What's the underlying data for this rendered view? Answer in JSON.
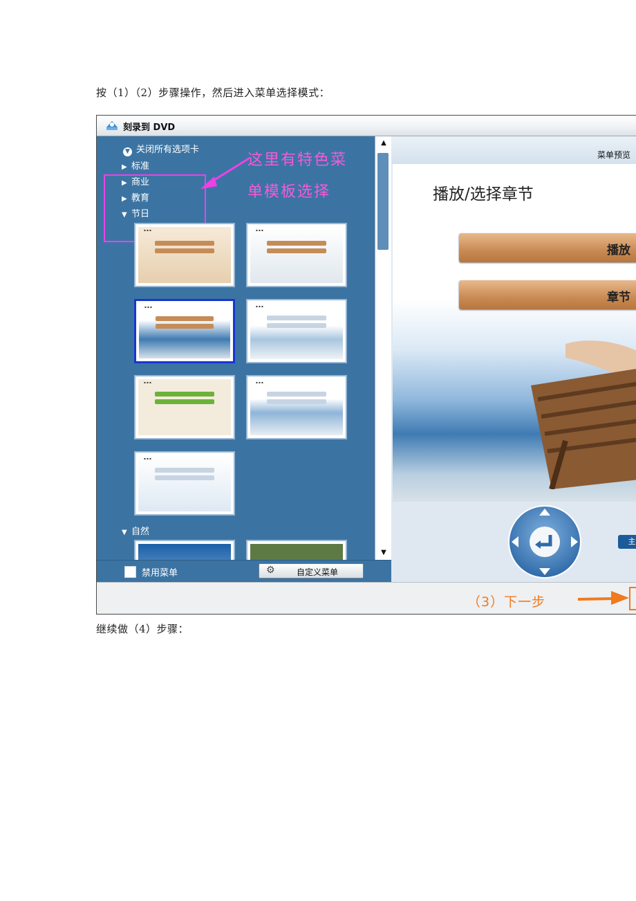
{
  "doc": {
    "para1": "按（1）（2）步骤操作，然后进入菜单选择模式：",
    "para2": "继续做（4）步骤："
  },
  "window": {
    "title": "刻录到 DVD",
    "close_all_tabs": "关闭所有选项卡",
    "tree": [
      {
        "label": "标准",
        "expanded": false
      },
      {
        "label": "商业",
        "expanded": false
      },
      {
        "label": "教育",
        "expanded": false
      },
      {
        "label": "节日",
        "expanded": true
      },
      {
        "label": "自然",
        "expanded": true
      }
    ],
    "thumbnail_count": 9,
    "selected_thumbnail": 3,
    "disable_menu": "禁用菜单",
    "custom_menu": "自定义菜单",
    "preview_header": "菜单预览",
    "preview_title": "播放/选择章节",
    "preview_buttons": [
      "播放",
      "章节"
    ],
    "main_button": "主"
  },
  "annotations": {
    "line1": "这里有特色菜",
    "line2": "单模板选择",
    "next_step": "（3）下一步"
  },
  "colors": {
    "panel_blue": "#3b74a3",
    "annotation_magenta": "#f13fe6",
    "annotation_orange": "#f07a1e",
    "selected_border": "#1836d0"
  }
}
